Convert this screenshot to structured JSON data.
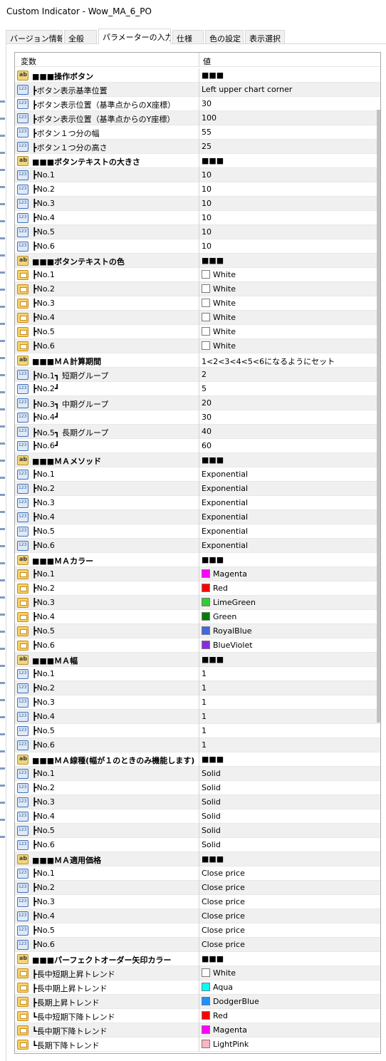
{
  "window": {
    "title": "Custom Indicator - Wow_MA_6_PO"
  },
  "tabs": [
    {
      "label": "バージョン情報",
      "active": false
    },
    {
      "label": "全般",
      "active": false
    },
    {
      "label": "パラメーターの入力",
      "active": true
    },
    {
      "label": "仕様",
      "active": false
    },
    {
      "label": "色の設定",
      "active": false
    },
    {
      "label": "表示選択",
      "active": false
    }
  ],
  "grid": {
    "col_variable": "変数",
    "col_value": "値",
    "rows": [
      {
        "icon": "string-icon",
        "name": "■■■操作ボタン",
        "value": "■■■"
      },
      {
        "icon": "number-icon",
        "name": "┣ボタン表示基準位置",
        "value": "Left upper chart corner"
      },
      {
        "icon": "number-icon",
        "name": "┣ボタン表示位置（基準点からのX座標）",
        "value": "30"
      },
      {
        "icon": "number-icon",
        "name": "┣ボタン表示位置（基準点からのY座標）",
        "value": "100"
      },
      {
        "icon": "number-icon",
        "name": "┣ボタン１つ分の幅",
        "value": "55"
      },
      {
        "icon": "number-icon",
        "name": "┣ボタン１つ分の高さ",
        "value": "25"
      },
      {
        "icon": "string-icon",
        "name": "■■■ボタンテキストの大きさ",
        "value": "■■■"
      },
      {
        "icon": "number-icon",
        "name": "┣No.1",
        "value": "10"
      },
      {
        "icon": "number-icon",
        "name": "┣No.2",
        "value": "10"
      },
      {
        "icon": "number-icon",
        "name": "┣No.3",
        "value": "10"
      },
      {
        "icon": "number-icon",
        "name": "┣No.4",
        "value": "10"
      },
      {
        "icon": "number-icon",
        "name": "┣No.5",
        "value": "10"
      },
      {
        "icon": "number-icon",
        "name": "┣No.6",
        "value": "10"
      },
      {
        "icon": "string-icon",
        "name": "■■■ボタンテキストの色",
        "value": "■■■"
      },
      {
        "icon": "color-icon",
        "name": "┣No.1",
        "value": "White",
        "swatch": "#ffffff"
      },
      {
        "icon": "color-icon",
        "name": "┣No.2",
        "value": "White",
        "swatch": "#ffffff"
      },
      {
        "icon": "color-icon",
        "name": "┣No.3",
        "value": "White",
        "swatch": "#ffffff"
      },
      {
        "icon": "color-icon",
        "name": "┣No.4",
        "value": "White",
        "swatch": "#ffffff"
      },
      {
        "icon": "color-icon",
        "name": "┣No.5",
        "value": "White",
        "swatch": "#ffffff"
      },
      {
        "icon": "color-icon",
        "name": "┣No.6",
        "value": "White",
        "swatch": "#ffffff"
      },
      {
        "icon": "string-icon",
        "name": "■■■ＭＡ計算期間",
        "value": "1<2<3<4<5<6になるようにセット"
      },
      {
        "icon": "number-icon",
        "name": "┣No.1┓ 短期グループ",
        "value": "2"
      },
      {
        "icon": "number-icon",
        "name": "┣No.2┛",
        "value": "5"
      },
      {
        "icon": "number-icon",
        "name": "┣No.3┓ 中期グループ",
        "value": "20"
      },
      {
        "icon": "number-icon",
        "name": "┣No.4┛",
        "value": "30"
      },
      {
        "icon": "number-icon",
        "name": "┣No.5┓ 長期グループ",
        "value": "40"
      },
      {
        "icon": "number-icon",
        "name": "┣No.6┛",
        "value": "60"
      },
      {
        "icon": "string-icon",
        "name": "■■■ＭＡメソッド",
        "value": "■■■"
      },
      {
        "icon": "number-icon",
        "name": "┣No.1",
        "value": "Exponential"
      },
      {
        "icon": "number-icon",
        "name": "┣No.2",
        "value": "Exponential"
      },
      {
        "icon": "number-icon",
        "name": "┣No.3",
        "value": "Exponential"
      },
      {
        "icon": "number-icon",
        "name": "┣No.4",
        "value": "Exponential"
      },
      {
        "icon": "number-icon",
        "name": "┣No.5",
        "value": "Exponential"
      },
      {
        "icon": "number-icon",
        "name": "┣No.6",
        "value": "Exponential"
      },
      {
        "icon": "string-icon",
        "name": "■■■ＭＡカラー",
        "value": "■■■"
      },
      {
        "icon": "color-icon",
        "name": "┣No.1",
        "value": "Magenta",
        "swatch": "#ff00ff"
      },
      {
        "icon": "color-icon",
        "name": "┣No.2",
        "value": "Red",
        "swatch": "#ff0000"
      },
      {
        "icon": "color-icon",
        "name": "┣No.3",
        "value": "LimeGreen",
        "swatch": "#32cd32"
      },
      {
        "icon": "color-icon",
        "name": "┣No.4",
        "value": "Green",
        "swatch": "#008000"
      },
      {
        "icon": "color-icon",
        "name": "┣No.5",
        "value": "RoyalBlue",
        "swatch": "#4169e1"
      },
      {
        "icon": "color-icon",
        "name": "┣No.6",
        "value": "BlueViolet",
        "swatch": "#8a2be2"
      },
      {
        "icon": "string-icon",
        "name": "■■■ＭＡ幅",
        "value": "■■■"
      },
      {
        "icon": "number-icon",
        "name": "┣No.1",
        "value": "1"
      },
      {
        "icon": "number-icon",
        "name": "┣No.2",
        "value": "1"
      },
      {
        "icon": "number-icon",
        "name": "┣No.3",
        "value": "1"
      },
      {
        "icon": "number-icon",
        "name": "┣No.4",
        "value": "1"
      },
      {
        "icon": "number-icon",
        "name": "┣No.5",
        "value": "1"
      },
      {
        "icon": "number-icon",
        "name": "┣No.6",
        "value": "1"
      },
      {
        "icon": "string-icon",
        "name": "■■■ＭＡ線種(幅が１のときのみ機能します)",
        "value": "■■■"
      },
      {
        "icon": "number-icon",
        "name": "┣No.1",
        "value": "Solid"
      },
      {
        "icon": "number-icon",
        "name": "┣No.2",
        "value": "Solid"
      },
      {
        "icon": "number-icon",
        "name": "┣No.3",
        "value": "Solid"
      },
      {
        "icon": "number-icon",
        "name": "┣No.4",
        "value": "Solid"
      },
      {
        "icon": "number-icon",
        "name": "┣No.5",
        "value": "Solid"
      },
      {
        "icon": "number-icon",
        "name": "┣No.6",
        "value": "Solid"
      },
      {
        "icon": "string-icon",
        "name": "■■■ＭＡ適用価格",
        "value": "■■■"
      },
      {
        "icon": "number-icon",
        "name": "┣No.1",
        "value": "Close price"
      },
      {
        "icon": "number-icon",
        "name": "┣No.2",
        "value": "Close price"
      },
      {
        "icon": "number-icon",
        "name": "┣No.3",
        "value": "Close price"
      },
      {
        "icon": "number-icon",
        "name": "┣No.4",
        "value": "Close price"
      },
      {
        "icon": "number-icon",
        "name": "┣No.5",
        "value": "Close price"
      },
      {
        "icon": "number-icon",
        "name": "┣No.6",
        "value": "Close price"
      },
      {
        "icon": "string-icon",
        "name": "■■■パーフェクトオーダー矢印カラー",
        "value": "■■■"
      },
      {
        "icon": "color-icon",
        "name": "┣長中短期上昇トレンド",
        "value": "White",
        "swatch": "#ffffff"
      },
      {
        "icon": "color-icon",
        "name": "┣長中期上昇トレンド",
        "value": "Aqua",
        "swatch": "#00ffff"
      },
      {
        "icon": "color-icon",
        "name": "┣長期上昇トレンド",
        "value": "DodgerBlue",
        "swatch": "#1e90ff"
      },
      {
        "icon": "color-icon",
        "name": "┗長中短期下降トレンド",
        "value": "Red",
        "swatch": "#ff0000"
      },
      {
        "icon": "color-icon",
        "name": "┗長中期下降トレンド",
        "value": "Magenta",
        "swatch": "#ff00ff"
      },
      {
        "icon": "color-icon",
        "name": "┗長期下降トレンド",
        "value": "LightPink",
        "swatch": "#ffb6c1"
      }
    ]
  }
}
